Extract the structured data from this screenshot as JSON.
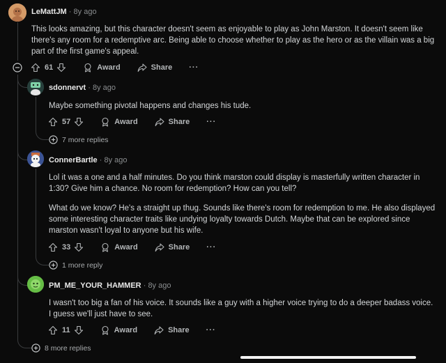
{
  "thread": {
    "top": {
      "username": "LeMattJM",
      "age": "8y ago",
      "body": "This looks amazing, but this character doesn't seem as enjoyable to play as John Marston. It doesn't seem like there's any room for a redemptive arc. Being able to choose whether to play as the hero or as the villain was a big part of the first game's appeal.",
      "score": "61",
      "award_label": "Award",
      "share_label": "Share",
      "more_label": "···",
      "collapse_icon": "minus-circle-icon"
    },
    "replies": [
      {
        "username": "sdonnervt",
        "age": "8y ago",
        "body": [
          "Maybe something pivotal happens and changes his tude."
        ],
        "score": "57",
        "award_label": "Award",
        "share_label": "Share",
        "more_label": "···",
        "more_replies": "7 more replies"
      },
      {
        "username": "ConnerBartle",
        "age": "8y ago",
        "body": [
          "Lol it was a one and a half minutes. Do you think marston could display is masterfully written character in 1:30? Give him a chance. No room for redemption? How can you tell?",
          "What do we know? He's a straight up thug. Sounds like there's room for redemption to me. He also displayed some interesting character traits like undying loyalty towards Dutch. Maybe that can be explored since marston wasn't loyal to anyone but his wife."
        ],
        "score": "33",
        "award_label": "Award",
        "share_label": "Share",
        "more_label": "···",
        "more_replies": "1 more reply"
      },
      {
        "username": "PM_ME_YOUR_HAMMER",
        "age": "8y ago",
        "body": [
          "I wasn't too big a fan of his voice. It sounds like a guy with a higher voice trying to do a deeper badass voice. I guess we'll just have to see."
        ],
        "score": "11",
        "award_label": "Award",
        "share_label": "Share",
        "more_label": "···"
      }
    ],
    "more_replies": "8 more replies",
    "separator": "·"
  },
  "colors": {
    "background": "#0b0b0b",
    "text": "#d3d6d8",
    "muted": "#8a8d8f",
    "thread_line": "#3a3c3e"
  }
}
